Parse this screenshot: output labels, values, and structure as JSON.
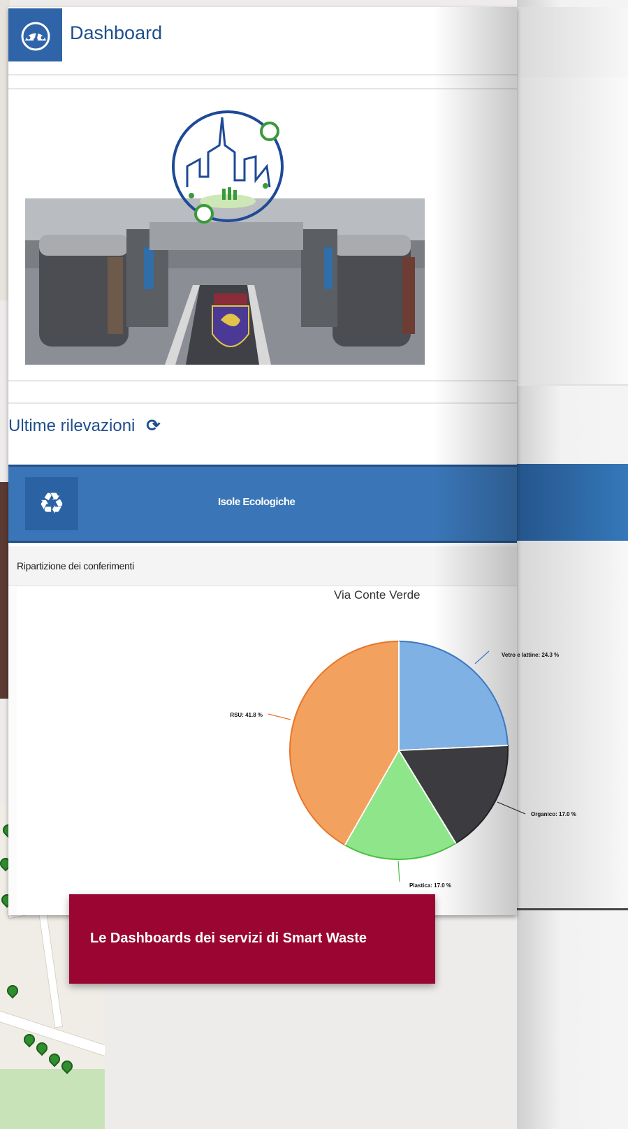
{
  "header": {
    "title": "Dashboard",
    "icon": "dashboard-gauge-icon"
  },
  "section": {
    "title": "Ultime rilevazioni",
    "refresh_icon": "refresh-icon"
  },
  "widget": {
    "title": "Isole Ecologiche",
    "icon": "recycle-icon",
    "panel_title": "Ripartizione dei conferimenti"
  },
  "chart_data": {
    "type": "pie",
    "title": "Via Conte Verde",
    "slices": [
      {
        "label": "Vetro e lattine: 24.3 %",
        "value": 24.3,
        "color": "#7fb1e5"
      },
      {
        "label": "Organico: 17.0 %",
        "value": 17.0,
        "color": "#3b3b40"
      },
      {
        "label": "Plastica: 17.0 %",
        "value": 17.0,
        "color": "#8fe68a"
      },
      {
        "label": "RSU: 41.8 %",
        "value": 41.8,
        "color": "#f2a25e"
      }
    ]
  },
  "caption": {
    "text": "Le Dashboards dei servizi di Smart Waste"
  },
  "colors": {
    "brand_blue": "#2f64a8",
    "caption_red": "#9a0532"
  }
}
